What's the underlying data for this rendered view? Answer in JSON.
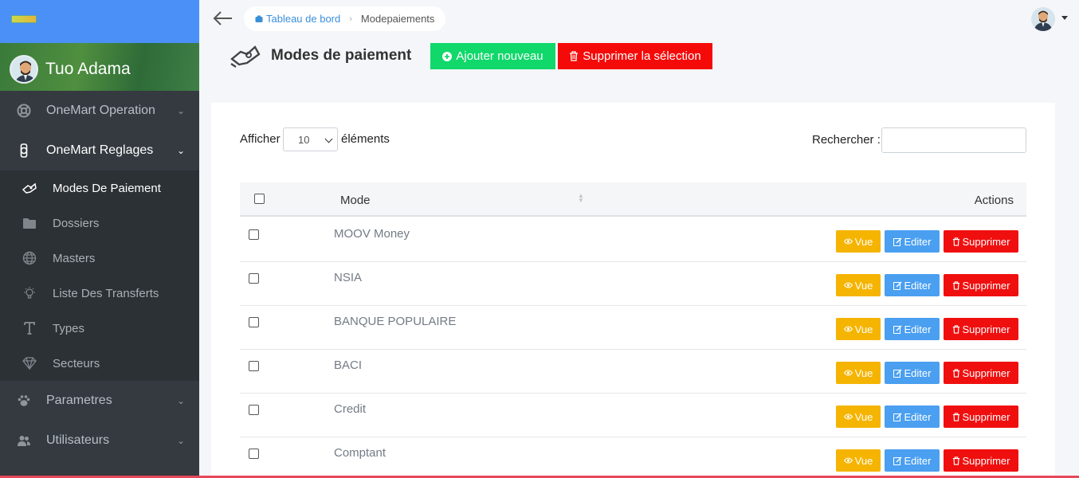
{
  "sidebar": {
    "user_name": "Tuo Adama",
    "menu": [
      {
        "label": "OneMart Operation"
      },
      {
        "label": "OneMart Reglages"
      },
      {
        "label": "Parametres"
      },
      {
        "label": "Utilisateurs"
      }
    ],
    "submenu": [
      {
        "label": "Modes De Paiement"
      },
      {
        "label": "Dossiers"
      },
      {
        "label": "Masters"
      },
      {
        "label": "Liste Des Transferts"
      },
      {
        "label": "Types"
      },
      {
        "label": "Secteurs"
      }
    ]
  },
  "breadcrumb": {
    "home": "Tableau de bord",
    "current": "Modepaiements"
  },
  "page": {
    "title": "Modes de paiement",
    "add_button": "Ajouter nouveau",
    "delete_selection_button": "Supprimer la sélection"
  },
  "table_controls": {
    "show_label": "Afficher",
    "page_size": "10",
    "elements_label": "éléments",
    "search_label": "Rechercher :"
  },
  "table": {
    "col_mode": "Mode",
    "col_actions": "Actions",
    "rows": [
      {
        "mode": "MOOV Money"
      },
      {
        "mode": "NSIA"
      },
      {
        "mode": "BANQUE POPULAIRE"
      },
      {
        "mode": "BACI"
      },
      {
        "mode": "Credit"
      },
      {
        "mode": "Comptant"
      }
    ],
    "btn_view": "Vue",
    "btn_edit": "Editer",
    "btn_delete": "Supprimer"
  },
  "colors": {
    "brand_bar": "#4a90f7",
    "sidebar": "#343a40",
    "add_green": "#10d86a",
    "delete_red": "#f50a0a",
    "view_yellow": "#f5b400",
    "edit_blue": "#4a9ff0"
  }
}
